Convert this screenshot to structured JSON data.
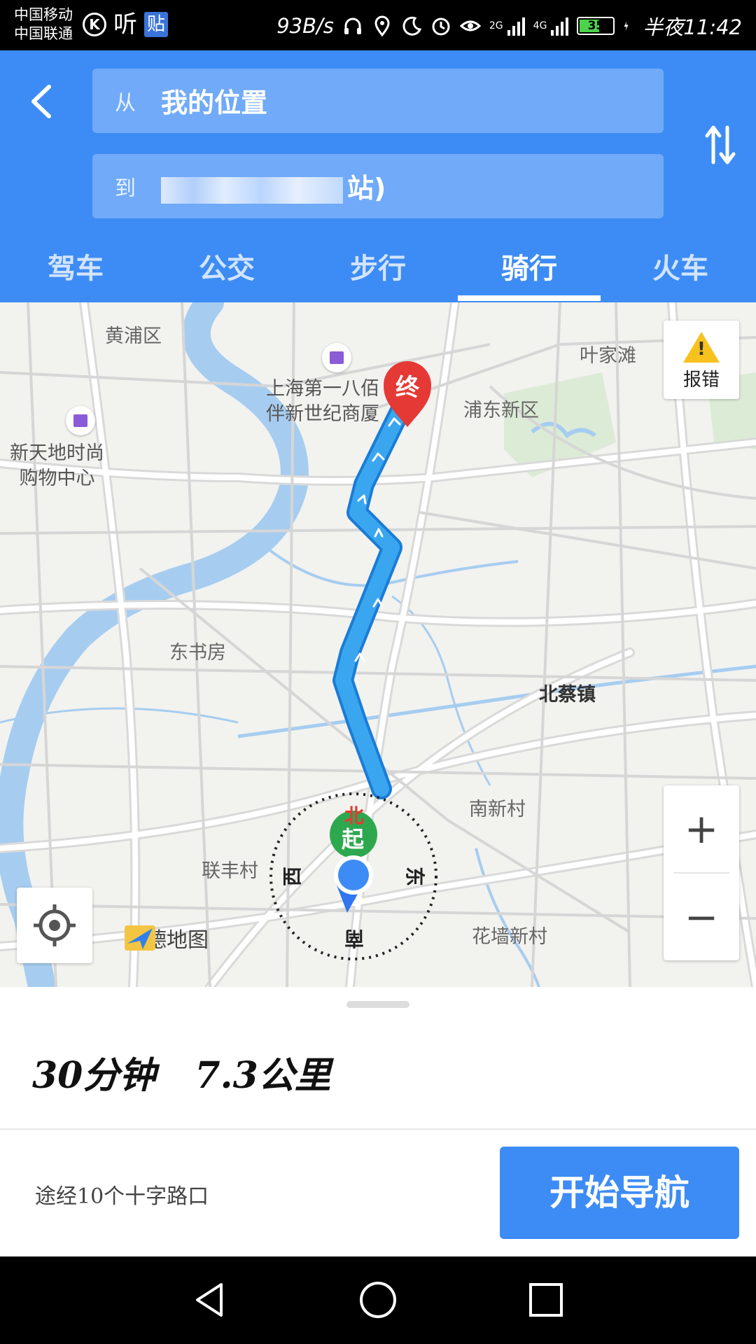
{
  "status_bar": {
    "carrier_1": "中国移动",
    "carrier_2": "中国联通",
    "app_k": "K",
    "app_ting": "听",
    "app_tie": "贴",
    "speed": "93B/s",
    "net_1": "2G",
    "net_2": "4G",
    "battery": "35",
    "time": "半夜11:42"
  },
  "header": {
    "from_label": "从",
    "from_value": "我的位置",
    "to_label": "到",
    "to_value_visible": "站)",
    "tabs": [
      "驾车",
      "公交",
      "步行",
      "骑行",
      "火车"
    ],
    "active_tab": "骑行"
  },
  "map": {
    "labels": {
      "huangpu": "黄浦区",
      "yejiazhai": "叶家滩",
      "pudong": "浦东新区",
      "dongshufang": "东书房",
      "beicaizhen": "北蔡镇",
      "nanxincun": "南新村",
      "lianfengcun": "联丰村",
      "huaqiangxincun": "花墙新村"
    },
    "poi_1_line1": "上海第一八佰",
    "poi_1_line2": "伴新世纪商厦",
    "poi_2_line1": "新天地时尚",
    "poi_2_line2": "购物中心",
    "end_pin": "终",
    "start_pin": "起",
    "compass": {
      "north": "北",
      "south": "南",
      "east": "东",
      "west": "西"
    },
    "report_label": "报错",
    "zoom_in": "+",
    "zoom_out": "−",
    "brand": "高德地图",
    "route_color": "#3aa6f0",
    "river_color": "#a6cdf0"
  },
  "panel": {
    "duration": "30分钟",
    "distance": "7.3公里",
    "via": "途经10个十字路口",
    "start_button": "开始导航"
  },
  "colors": {
    "accent": "#3d8cf5",
    "end_pin": "#e53935",
    "start_pin": "#2ea84f"
  }
}
